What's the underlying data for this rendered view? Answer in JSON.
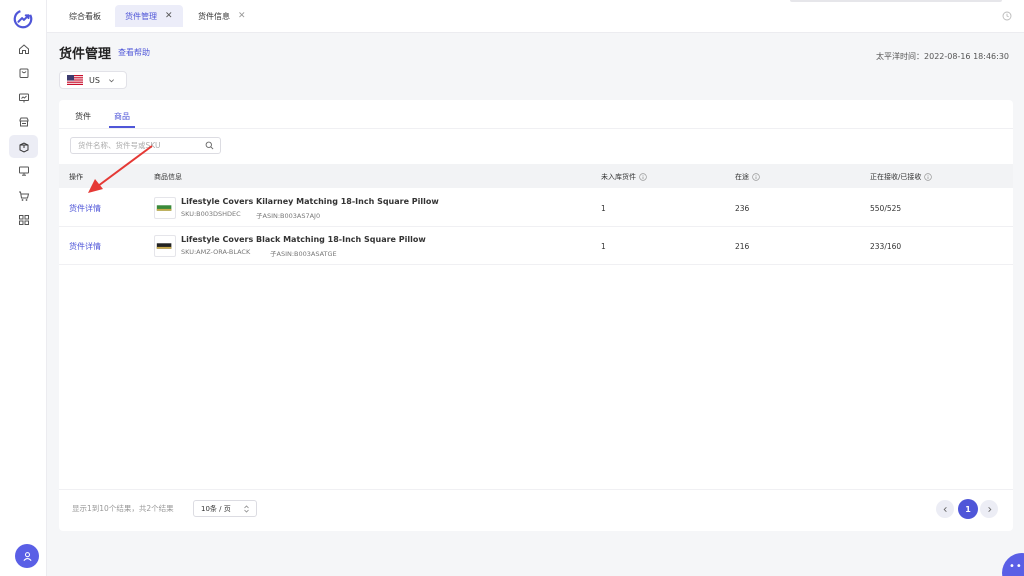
{
  "colors": {
    "accent": "#4f56d8",
    "arrow": "#e53935",
    "avatar": "#5a5fe6"
  },
  "sidebar": {
    "logo_icon": "trend-logo-icon",
    "items": [
      {
        "icon": "home-icon",
        "active": false
      },
      {
        "icon": "bag-icon",
        "active": false
      },
      {
        "icon": "chart-screen-icon",
        "active": false
      },
      {
        "icon": "store-icon",
        "active": false
      },
      {
        "icon": "package-icon",
        "active": true
      },
      {
        "icon": "monitor-icon",
        "active": false
      },
      {
        "icon": "cart-icon",
        "active": false
      },
      {
        "icon": "apps-grid-icon",
        "active": false
      }
    ],
    "avatar_icon": "user-icon"
  },
  "topbar": {
    "tabs": [
      {
        "label": "综合看板",
        "active": false,
        "closable": false
      },
      {
        "label": "货件管理",
        "active": true,
        "closable": true
      },
      {
        "label": "货件信息",
        "active": false,
        "closable": true
      }
    ],
    "close_glyph": "✕"
  },
  "header": {
    "title": "货件管理",
    "help_link": "查看帮助",
    "time_label": "太平洋时间：2022-08-16 18:46:30"
  },
  "region": {
    "value": "US",
    "flag_icon": "us-flag-icon"
  },
  "subtabs": [
    {
      "label": "货件",
      "active": false
    },
    {
      "label": "商品",
      "active": true
    }
  ],
  "search": {
    "placeholder": "货件名称、货件号或SKU",
    "value": ""
  },
  "table": {
    "columns": [
      {
        "label": "操作",
        "info": false
      },
      {
        "label": "商品信息",
        "info": false
      },
      {
        "label": "未入库货件",
        "info": true
      },
      {
        "label": "在途",
        "info": true
      },
      {
        "label": "正在接收/已接收",
        "info": true
      }
    ],
    "rows": [
      {
        "action": "货件详情",
        "name": "Lifestyle Covers Kilarney Matching 18-Inch Square Pillow",
        "sku": "SKU:B003DSHDEC",
        "asin": "子ASIN:B003AS7AJ0",
        "thumb_color": "#3a8a3a",
        "pending": "1",
        "in_transit": "236",
        "receiving": "550/525"
      },
      {
        "action": "货件详情",
        "name": "Lifestyle Covers Black Matching 18-Inch Square Pillow",
        "sku": "SKU:AMZ-ORA-BLACK",
        "asin": "子ASIN:B003ASATGE",
        "thumb_color": "#222222",
        "pending": "1",
        "in_transit": "216",
        "receiving": "233/160"
      }
    ]
  },
  "footer": {
    "summary": "显示1到10个结果，共2个结果",
    "page_size": "10条 / 页",
    "current_page": "1"
  },
  "chat": {
    "dots": "•••"
  }
}
